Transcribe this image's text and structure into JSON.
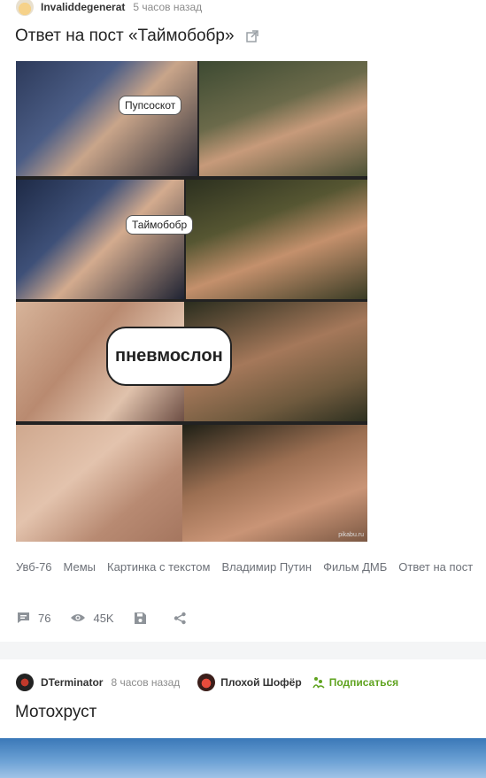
{
  "post1": {
    "author": "Invaliddegenerat",
    "time": "5 часов назад",
    "title": "Ответ на пост «Таймобобр»",
    "meme": {
      "bubbles": [
        "Пупсоскот",
        "Таймобобр",
        "пневмослон"
      ],
      "watermark": "pikabu.ru"
    },
    "tags": [
      "Увб-76",
      "Мемы",
      "Картинка с текстом",
      "Владимир Путин",
      "Фильм ДМБ",
      "Ответ на пост"
    ],
    "stats": {
      "comments": "76",
      "views": "45K"
    }
  },
  "post2": {
    "author": "DTerminator",
    "time": "8 часов назад",
    "community": "Плохой Шофёр",
    "subscribe": "Подписаться",
    "title": "Мотохруст"
  },
  "colors": {
    "accent_green": "#5fa31f",
    "muted": "#8c8c8c",
    "separator": "#f4f5f6"
  }
}
